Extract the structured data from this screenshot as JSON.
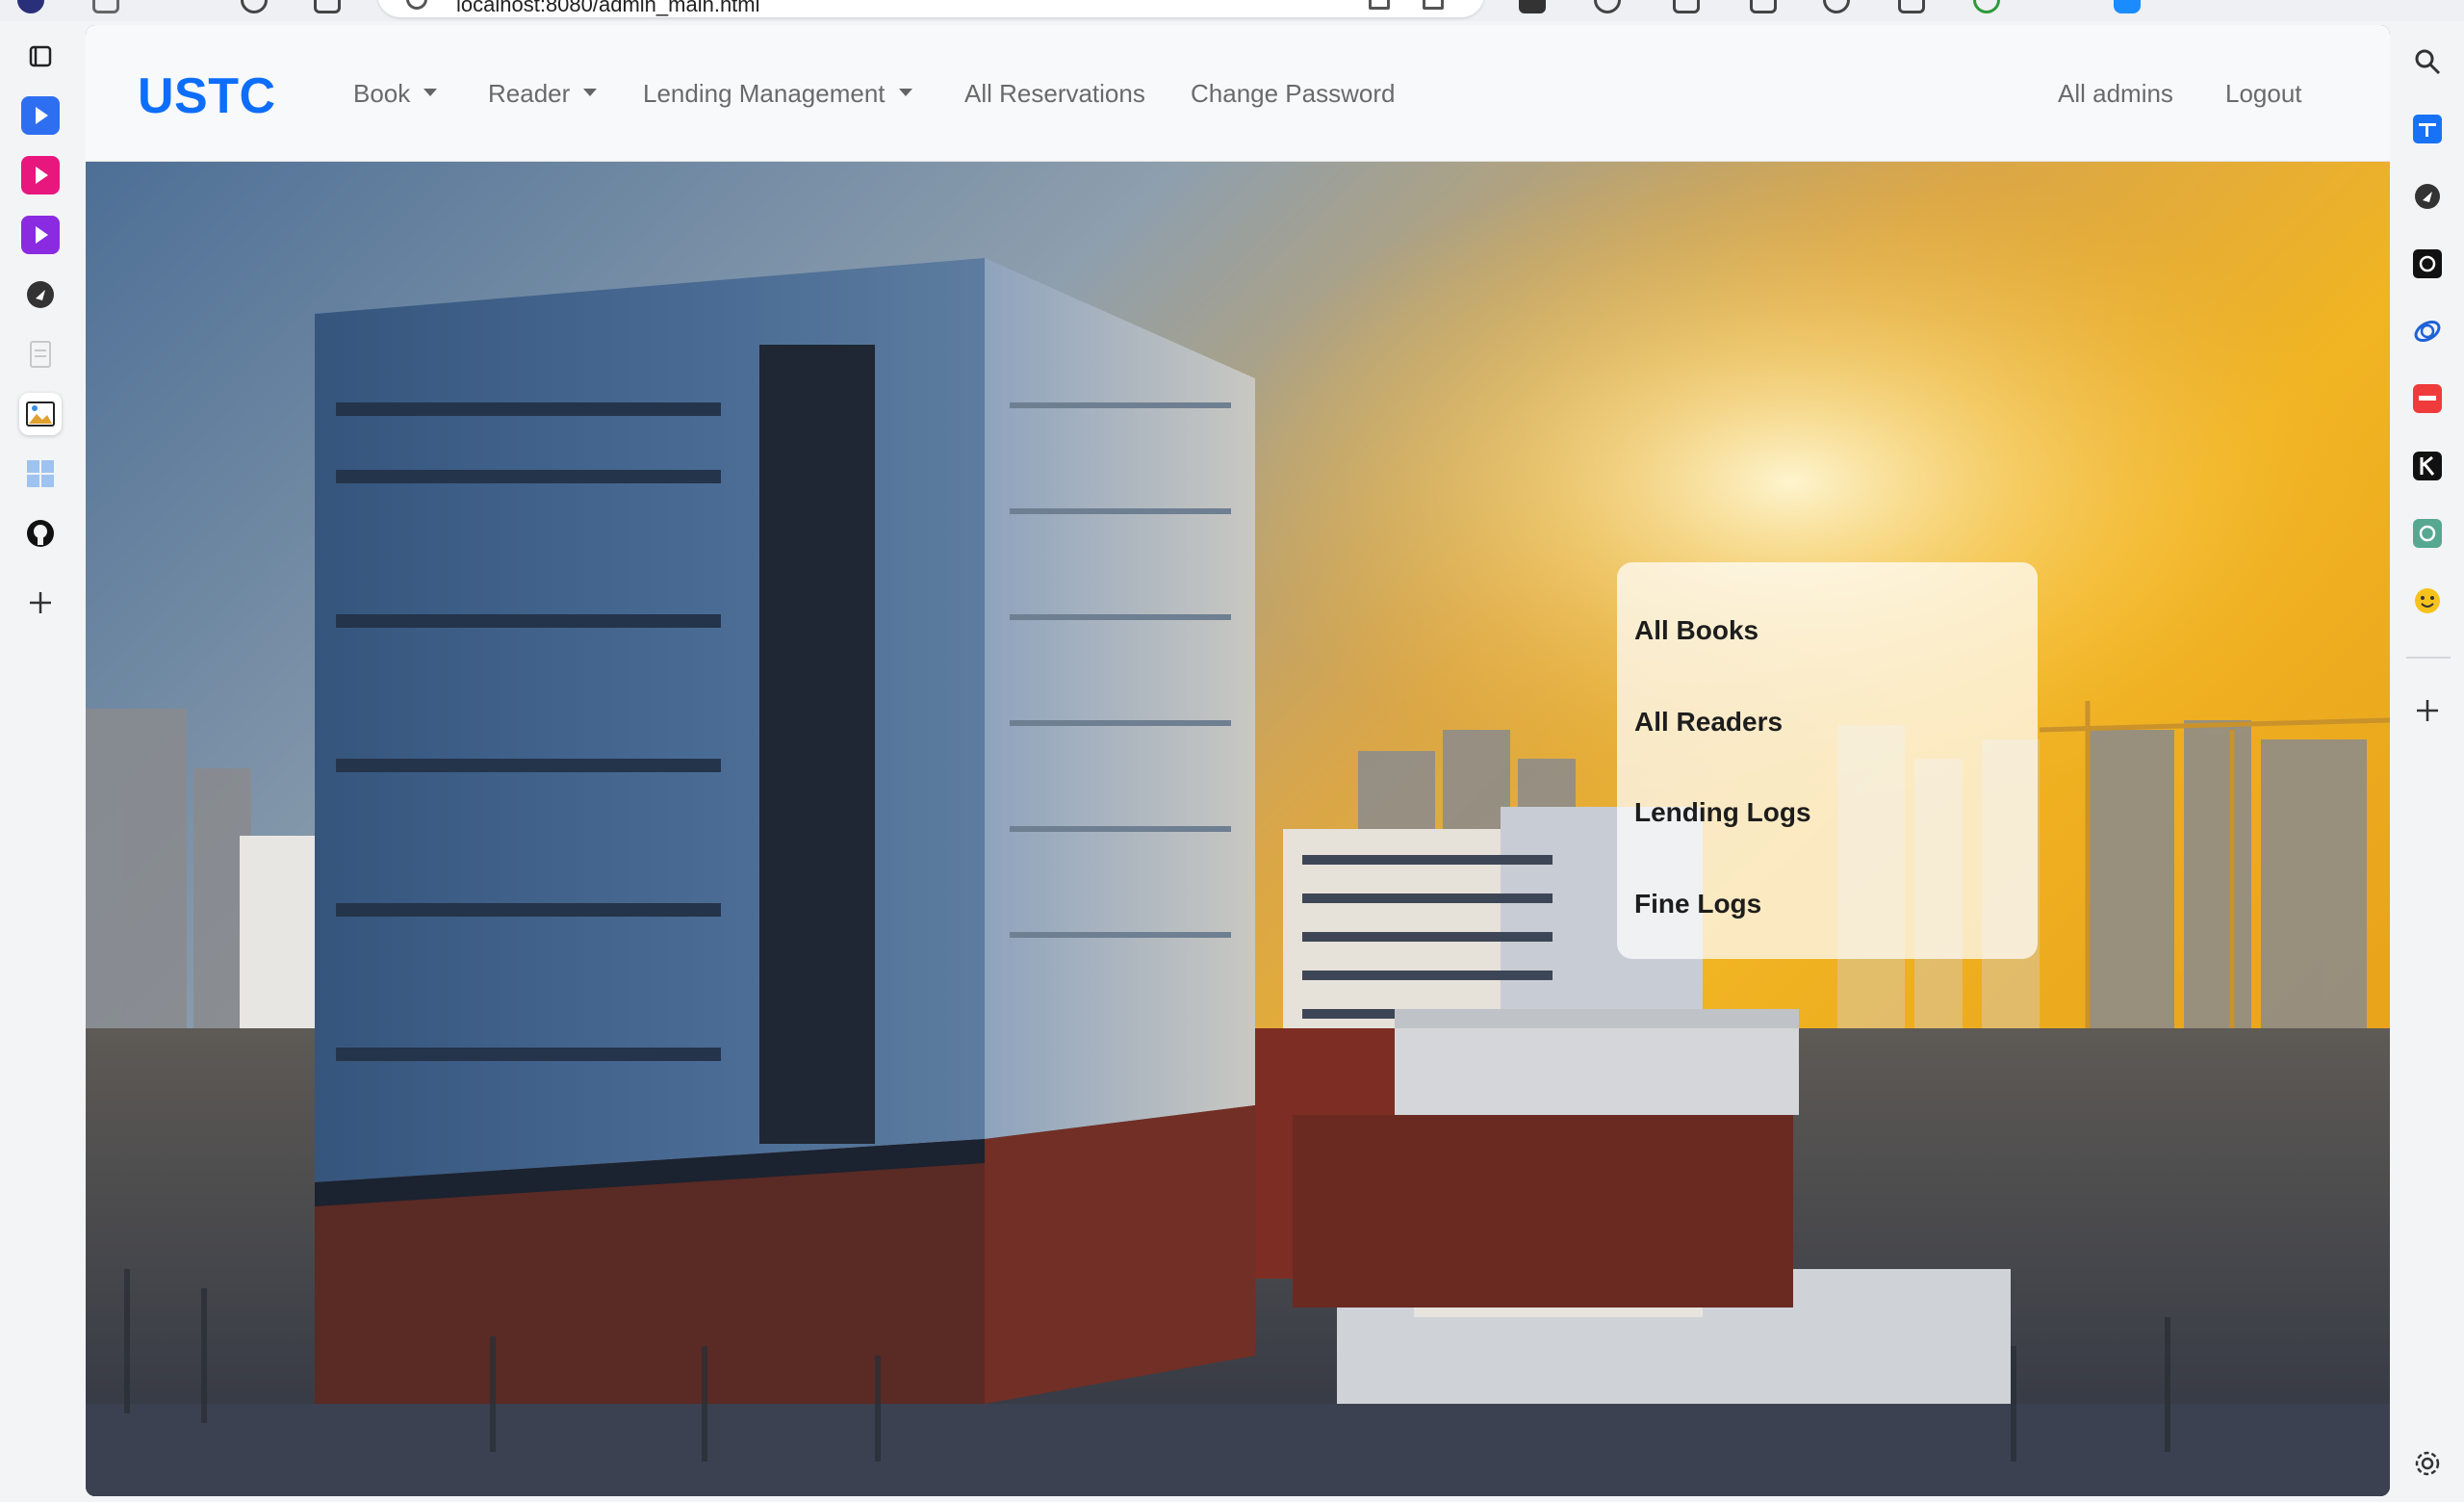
{
  "app": {
    "brand": "USTC"
  },
  "browser": {
    "url": "localhost:8080/admin_main.html"
  },
  "navbar": {
    "items": [
      {
        "label": "Book",
        "dropdown": true
      },
      {
        "label": "Reader",
        "dropdown": true
      },
      {
        "label": "Lending Management",
        "dropdown": true
      },
      {
        "label": "All Reservations",
        "dropdown": false
      },
      {
        "label": "Change Password",
        "dropdown": false
      }
    ],
    "right_items": [
      {
        "label": "All admins"
      },
      {
        "label": "Logout"
      }
    ]
  },
  "dropdown": {
    "items": [
      {
        "label": "All Books"
      },
      {
        "label": "All Readers"
      },
      {
        "label": "Lending Logs"
      },
      {
        "label": "Fine Logs"
      }
    ]
  },
  "left_sidebar": {
    "icons": [
      "tabs-icon",
      "video-play-icon",
      "media-play-icon",
      "purple-play-icon",
      "dark-play-icon",
      "document-icon",
      "image-icon",
      "grid-app-icon",
      "github-icon",
      "add-icon"
    ]
  },
  "right_sidebar": {
    "icons": [
      "search-icon",
      "zhihu-icon",
      "dark-play-icon",
      "openai-icon",
      "orbit-icon",
      "red-app-icon",
      "k-app-icon",
      "chatgpt-icon",
      "smiley-icon",
      "add-icon",
      "settings-icon"
    ]
  },
  "colors": {
    "brand": "#0d6efd",
    "navbar_bg": "#f8f9fa",
    "nav_text": "#6c757d",
    "dropdown_bg": "rgba(255,255,255,0.72)"
  }
}
